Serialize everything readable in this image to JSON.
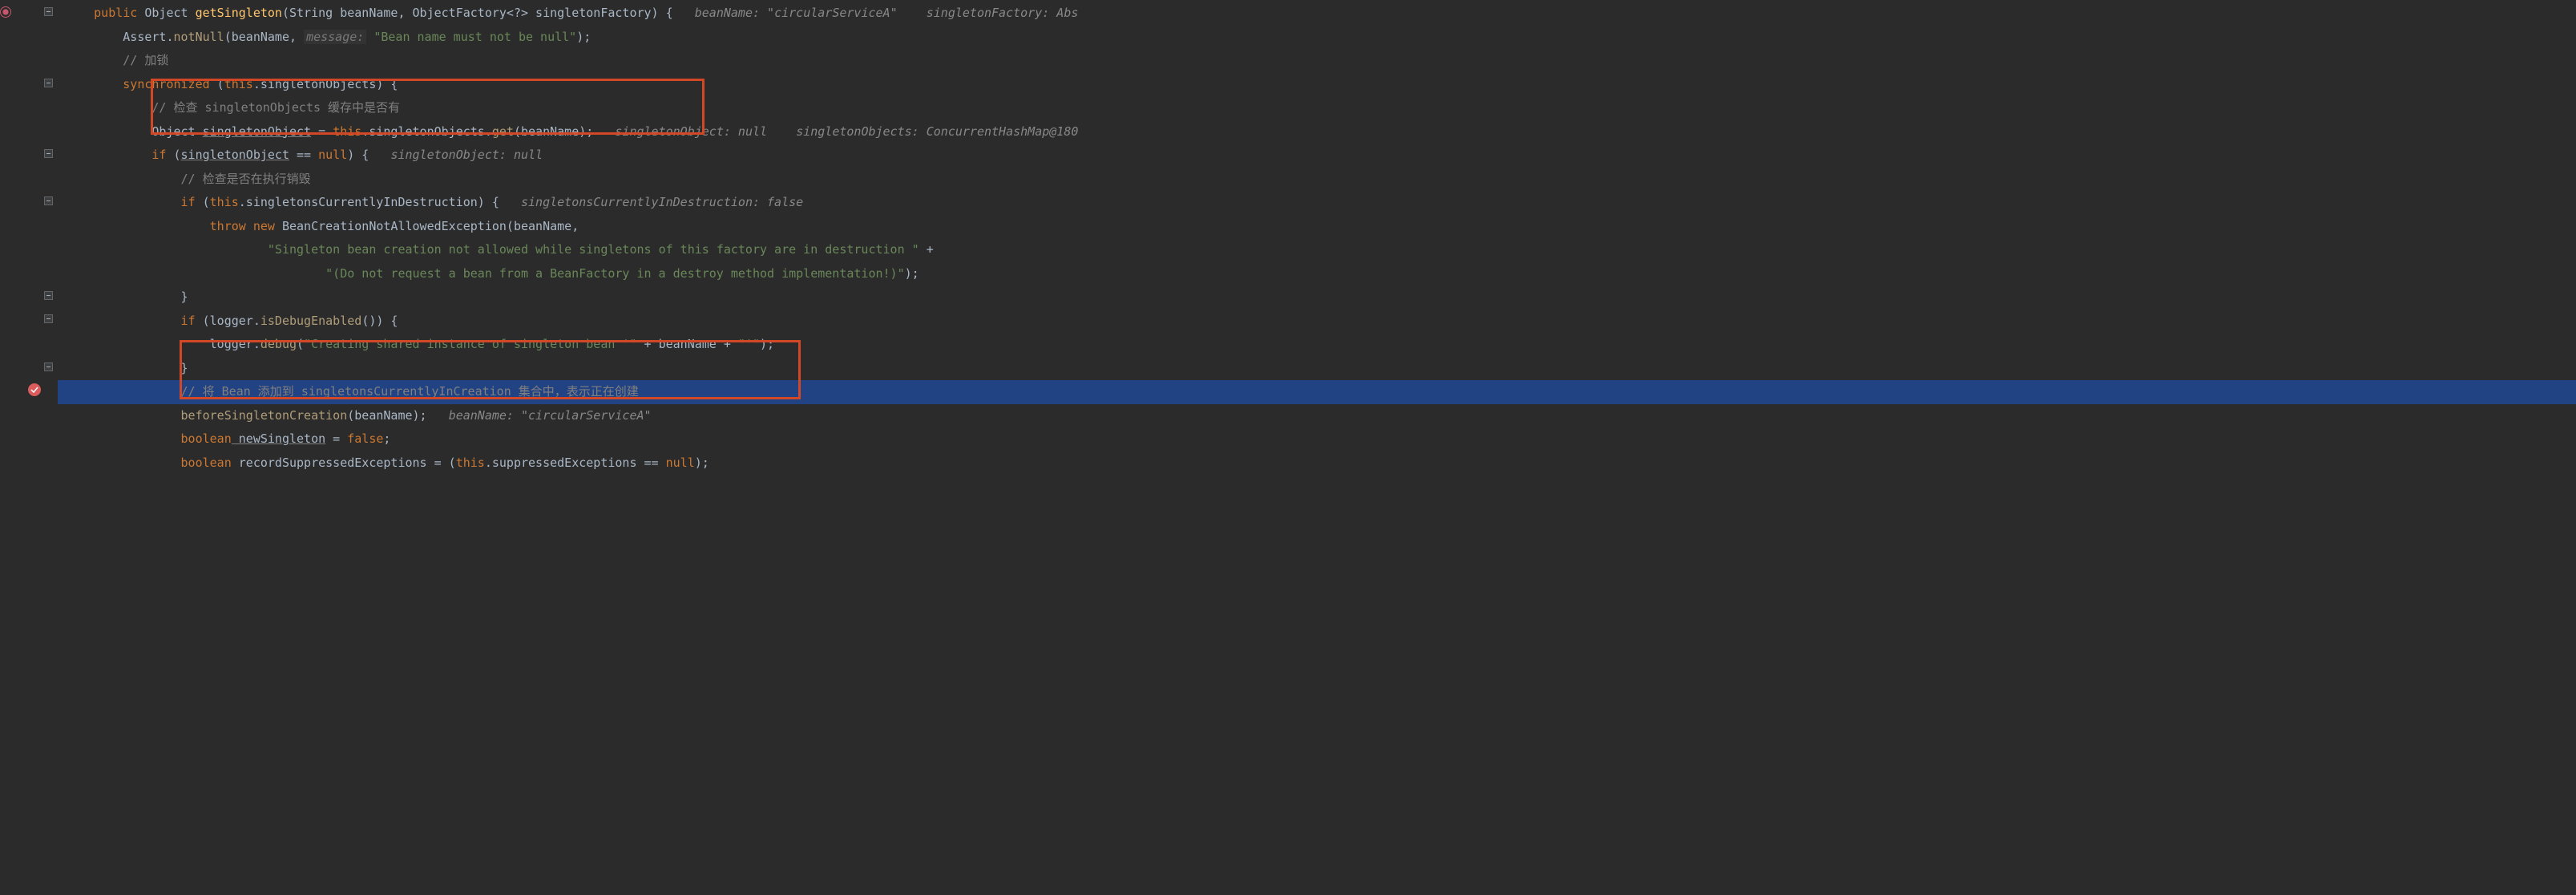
{
  "code": {
    "l1": {
      "kw_public": "public",
      "type_object": "Object",
      "method": "getSingleton",
      "params": "(String beanName, ObjectFactory<?> singletonFactory) {",
      "inlay1": "beanName: \"circularServiceA\"",
      "inlay2": "singletonFactory: Abs"
    },
    "l2": {
      "assert": "Assert.",
      "notnull": "notNull",
      "open": "(beanName, ",
      "hint": "message:",
      "str": "\"Bean name must not be null\"",
      "close": ");"
    },
    "l3": {
      "comment": "// 加锁"
    },
    "l4": {
      "kw": "synchronized",
      "open": " (",
      "this": "this",
      "dot_field": ".singletonObjects",
      "close": ") {"
    },
    "l5": {
      "comment": "// 检查 singletonObjects 缓存中是否有"
    },
    "l6": {
      "type": "Object ",
      "var": "singletonObject",
      "eq": " = ",
      "this": "this",
      "dot1": ".singletonObjects.",
      "get": "get",
      "args": "(beanName);",
      "inlay1": "singletonObject: null",
      "inlay2": "singletonObjects: ConcurrentHashMap@180"
    },
    "l7": {
      "kw_if": "if",
      "open": " (",
      "var": "singletonObject",
      "rest": " == ",
      "null": "null",
      "close": ") {",
      "inlay": "singletonObject: null"
    },
    "l8": {
      "comment": "// 检查是否在执行销毁"
    },
    "l9": {
      "kw_if": "if",
      "open": " (",
      "this": "this",
      "field": ".singletonsCurrentlyInDestruction) {",
      "inlay": "singletonsCurrentlyInDestruction: false"
    },
    "l10": {
      "throw": "throw",
      "new": " new",
      "ex": " BeanCreationNotAllowedException(beanName,"
    },
    "l11": {
      "str": "\"Singleton bean creation not allowed while singletons of this factory are in destruction \"",
      "plus": " +"
    },
    "l12": {
      "str": "\"(Do not request a bean from a BeanFactory in a destroy method implementation!)\"",
      "close": ");"
    },
    "l13": {
      "brace": "}"
    },
    "l14": {
      "kw_if": "if",
      "open": " (logger.",
      "call": "isDebugEnabled",
      "close": "()) {"
    },
    "l15": {
      "logger": "logger.",
      "debug": "debug",
      "open": "(",
      "str1": "\"Creating shared instance of singleton bean '\"",
      "plus1": " + beanName + ",
      "str2": "\"'\"",
      "close": ");"
    },
    "l16": {
      "brace": "}"
    },
    "l17": {
      "comment": "// 将 Bean 添加到 singletonsCurrentlyInCreation 集合中，表示正在创建"
    },
    "l18": {
      "call": "beforeSingletonCreation",
      "args": "(beanName);",
      "inlay": "beanName: \"circularServiceA\""
    },
    "l19": {
      "kw": "boolean",
      "var": " newSingleton",
      "eq": " = ",
      "val": "false",
      "semi": ";"
    },
    "l20": {
      "kw": "boolean",
      "var": " recordSuppressedExceptions = (",
      "this": "this",
      "field": ".suppressedExceptions == ",
      "null": "null",
      "close": ");"
    }
  }
}
